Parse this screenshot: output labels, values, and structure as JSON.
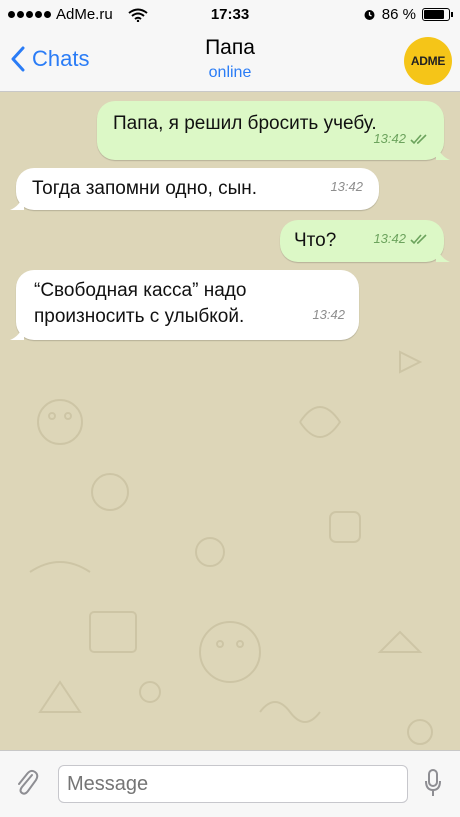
{
  "status_bar": {
    "carrier": "AdMe.ru",
    "time": "17:33",
    "battery": "86 %",
    "battery_level": 0.86
  },
  "header": {
    "back_label": "Chats",
    "contact_name": "Папа",
    "contact_status": "online",
    "avatar_text": "ADME"
  },
  "messages": [
    {
      "direction": "out",
      "text": "Папа, я решил бросить учебу.",
      "time": "13:42"
    },
    {
      "direction": "in",
      "text": "Тогда запомни одно, сын.",
      "time": "13:42"
    },
    {
      "direction": "out",
      "text": "Что?",
      "time": "13:42"
    },
    {
      "direction": "in",
      "text": "“Свободная касса” надо\nпроизносить с улыбкой.",
      "time": "13:42"
    }
  ],
  "composer": {
    "placeholder": "Message"
  },
  "colors": {
    "accent": "#2a7cf6",
    "outgoing_bubble": "#dcf8c6",
    "incoming_bubble": "#ffffff",
    "chat_background": "#ddd6b8",
    "avatar": "#f5c518"
  },
  "icons": [
    "signal-dots-icon",
    "wifi-icon",
    "alarm-icon",
    "battery-icon",
    "chevron-left-icon",
    "double-check-icon",
    "paperclip-icon",
    "microphone-icon"
  ]
}
